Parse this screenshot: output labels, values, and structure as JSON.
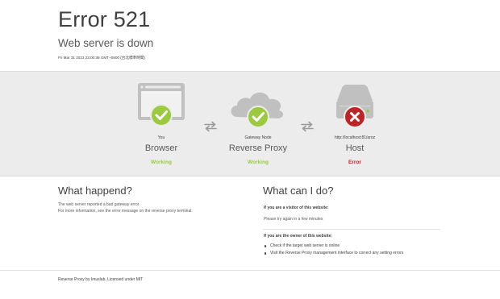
{
  "header": {
    "title": "Error 521",
    "subtitle": "Web server is down",
    "timestamp": "Fri Mar 31 2023 23:00:38 GMT+0800 (台北標準時間)"
  },
  "colors": {
    "ok": "#9bca3e",
    "error": "#bd2426",
    "icon_gray": "#bfbfbf",
    "band": "#ececec"
  },
  "nodes": [
    {
      "sub": "You",
      "name": "Browser",
      "status": "Working",
      "state": "ok",
      "icon": "browser-window-icon"
    },
    {
      "sub": "Gateway Node",
      "name": "Reverse Proxy",
      "status": "Working",
      "state": "ok",
      "icon": "cloud-icon"
    },
    {
      "sub": "http://localhost:81/aroz",
      "name": "Host",
      "status": "Error",
      "state": "error",
      "icon": "server-icon"
    }
  ],
  "what_happened": {
    "title": "What happend?",
    "line1": "The web server reported a bad gateway error.",
    "line2": "For more information, see the error message on the reverse proxy terminal."
  },
  "what_can_i_do": {
    "title": "What can I do?",
    "visitor_heading": "If you are a visitor of this website:",
    "visitor_text": "Please try again in a few minutes",
    "owner_heading": "If you are the owner of this website:",
    "owner_items": [
      "Check if the target web server is online",
      "Visit the Reverse Proxy management interface to correct any setting errors"
    ]
  },
  "footer": {
    "text": "Reverse Proxy by Imuslab, Licensed under MIT"
  }
}
